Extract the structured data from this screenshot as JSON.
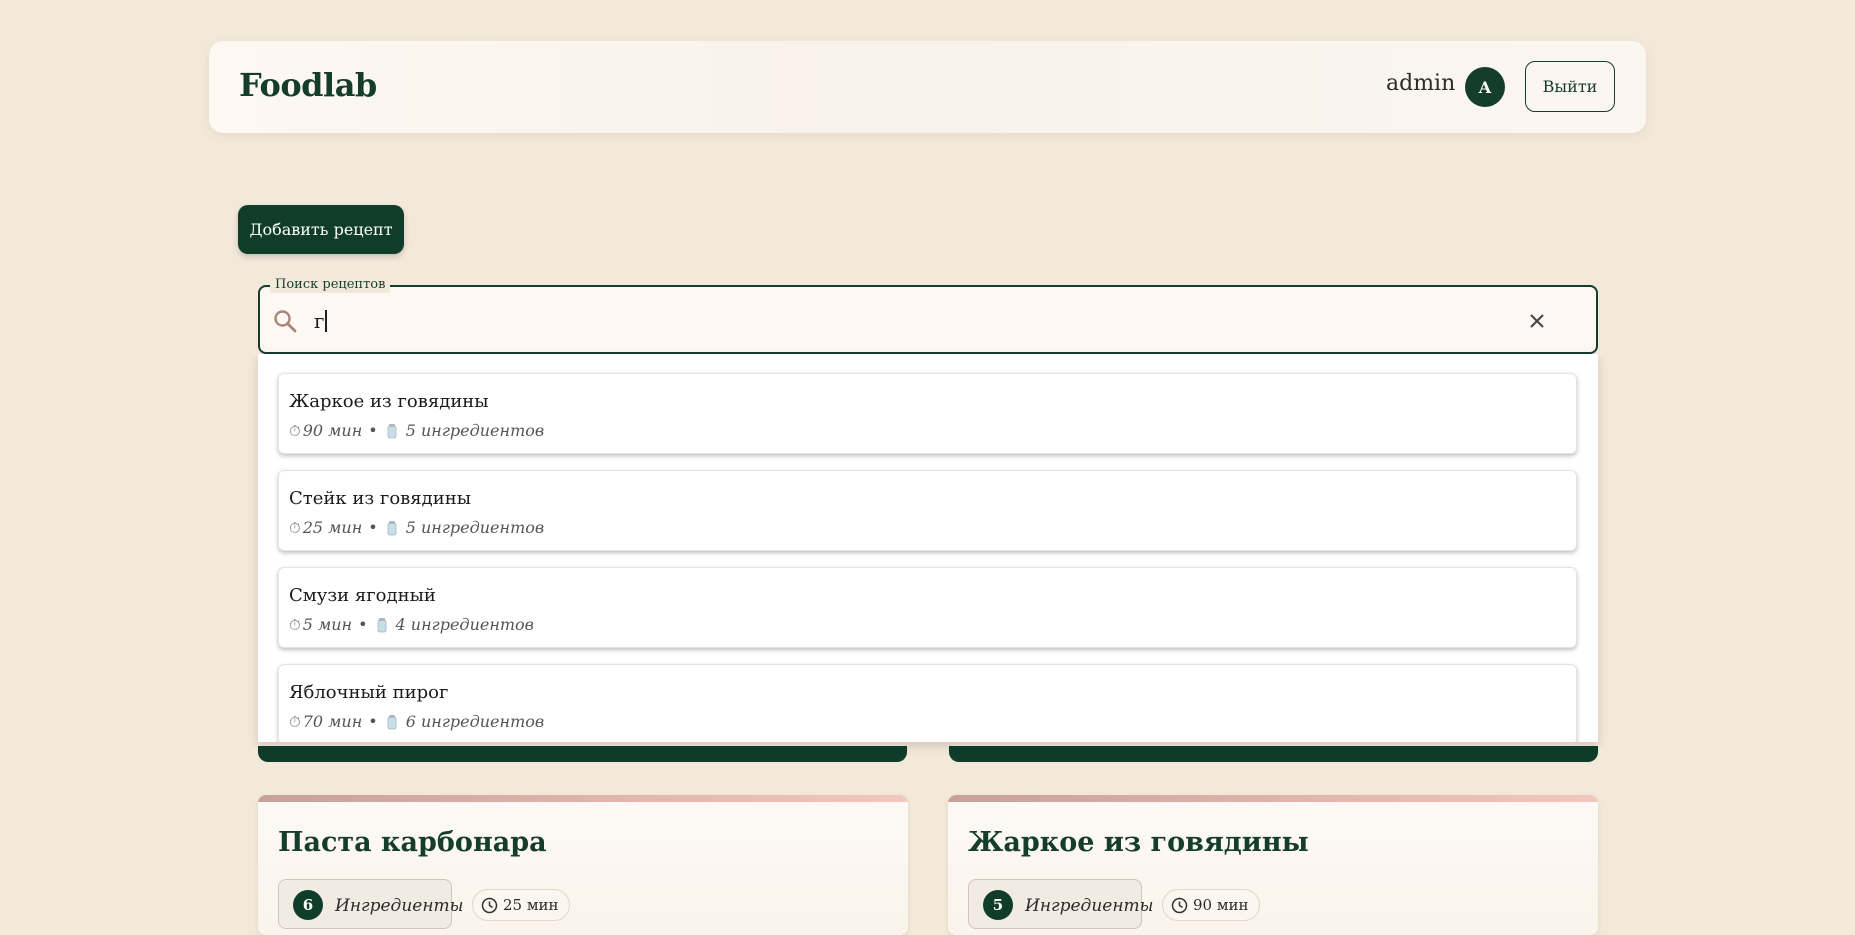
{
  "header": {
    "logo": "Foodlab",
    "username": "admin",
    "avatar_initial": "A",
    "logout_label": "Выйти"
  },
  "actions": {
    "add_recipe_label": "Добавить рецепт"
  },
  "search": {
    "legend": "Поиск рецептов",
    "value": "г",
    "icon": "search-icon",
    "clear_icon": "close-icon"
  },
  "suggestions": [
    {
      "title": "Жаркое из говядины",
      "time": "90 мин",
      "separator": "•",
      "ingredients": "5 ингредиентов"
    },
    {
      "title": "Стейк из говядины",
      "time": "25 мин",
      "separator": "•",
      "ingredients": "5 ингредиентов"
    },
    {
      "title": "Смузи ягодный",
      "time": "5 мин",
      "separator": "•",
      "ingredients": "4 ингредиентов"
    },
    {
      "title": "Яблочный пирог",
      "time": "70 мин",
      "separator": "•",
      "ingredients": "6 ингредиентов"
    }
  ],
  "cards": [
    {
      "title": "Паста карбонара",
      "ingredient_count": "6",
      "ingredient_label": "Ингредиенты",
      "time": "25 мин"
    },
    {
      "title": "Жаркое из говядины",
      "ingredient_count": "5",
      "ingredient_label": "Ингредиенты",
      "time": "90 мин"
    }
  ],
  "colors": {
    "background": "#f3e9da",
    "primary": "#0f3d2a",
    "accent_bar": "#e3b7ad"
  }
}
